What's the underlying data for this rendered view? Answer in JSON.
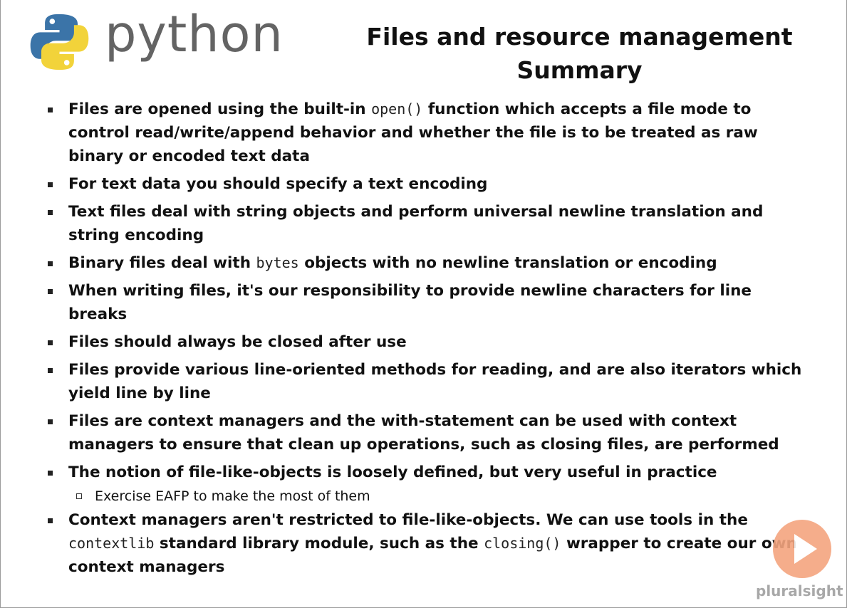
{
  "logo": {
    "wordmark": "python",
    "icon": "python-logo-icon"
  },
  "title": {
    "line1": "Files and resource management",
    "line2": "Summary"
  },
  "bullets": [
    {
      "before": "Files are opened using the built-in ",
      "code": "open()",
      "after": " function which accepts a file mode to control read/write/append behavior and whether the file is to be treated as raw binary or encoded text data"
    },
    {
      "text": "For text data you should specify a text encoding"
    },
    {
      "text": "Text files deal with string objects and perform universal newline translation and string encoding"
    },
    {
      "before": "Binary files deal with ",
      "code": "bytes",
      "after": " objects with no newline translation or encoding"
    },
    {
      "text": "When writing files, it's our responsibility to provide newline characters for line breaks"
    },
    {
      "text": "Files should always be closed after use"
    },
    {
      "text": "Files provide various line-oriented methods for reading, and are also iterators which yield line by line"
    },
    {
      "text": "Files are context managers and the with-statement can be used with context managers to ensure that clean up operations, such as closing files, are performed"
    },
    {
      "text": "The notion of file-like-objects is loosely defined, but very useful in practice"
    },
    {
      "sub": "Exercise EAFP to make the most of them"
    },
    {
      "before": "Context managers aren't restricted to file-like-objects.  We can use tools in the ",
      "code1": "contextlib",
      "middle": " standard library module, such as the ",
      "code2": "closing()",
      "after": " wrapper to create our own context managers"
    }
  ],
  "watermark": {
    "text": "pluralsight",
    "icon": "play-icon",
    "accent": "#f4a57f"
  }
}
